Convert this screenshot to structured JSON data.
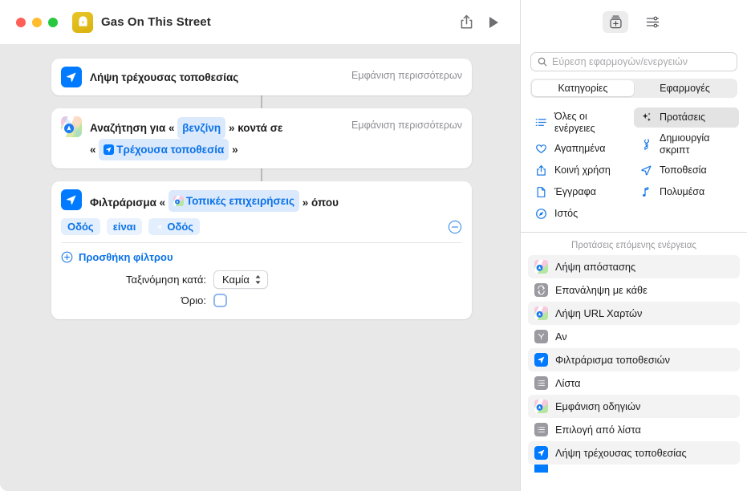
{
  "window": {
    "title": "Gas On This Street",
    "app_icon": "gas-pump-icon",
    "traffic_lights": [
      "close",
      "minimize",
      "zoom"
    ],
    "toolbar": {
      "share_label": "share-icon",
      "play_label": "play-icon"
    }
  },
  "workflow": {
    "actions": [
      {
        "icon": "location-arrow-icon",
        "text_before": "Λήψη τρέχουσας τοποθεσίας",
        "show_more": "Εμφάνιση περισσότερων"
      },
      {
        "icon": "maps-icon",
        "prefix": "Αναζήτηση για «",
        "token1": "βενζίνη",
        "middle": "» κοντά σε",
        "open_quote": "«",
        "token2": "Τρέχουσα τοποθεσία",
        "close_quote": "»",
        "show_more": "Εμφάνιση περισσότερων"
      },
      {
        "icon": "location-arrow-icon",
        "prefix": "Φιλτράρισμα «",
        "token": "Τοπικές επιχειρήσεις",
        "suffix": "» όπου",
        "filter_row": {
          "field": "Οδός",
          "operator": "είναι",
          "value": "Οδός"
        },
        "add_filter": "Προσθήκη φίλτρου",
        "sort_label": "Ταξινόμηση κατά:",
        "sort_value": "Καμία",
        "limit_label": "Όριο:",
        "limit_checked": false
      }
    ]
  },
  "sidebar": {
    "top_tabs": [
      {
        "name": "library-add-icon",
        "active": true
      },
      {
        "name": "sliders-icon",
        "active": false
      }
    ],
    "search": {
      "placeholder": "Εύρεση εφαρμογών/ενεργειών",
      "value": ""
    },
    "segmented": {
      "options": [
        "Κατηγορίες",
        "Εφαρμογές"
      ],
      "selected": "Κατηγορίες"
    },
    "categories_left": [
      {
        "icon": "list-bullet-icon",
        "label": "Όλες οι ενέργειες",
        "selected": false
      },
      {
        "icon": "heart-icon",
        "label": "Αγαπημένα",
        "selected": false
      },
      {
        "icon": "share-up-icon",
        "label": "Κοινή χρήση",
        "selected": false
      },
      {
        "icon": "document-icon",
        "label": "Έγγραφα",
        "selected": false
      },
      {
        "icon": "safari-compass-icon",
        "label": "Ιστός",
        "selected": false
      }
    ],
    "categories_right": [
      {
        "icon": "sparkles-icon",
        "label": "Προτάσεις",
        "selected": true
      },
      {
        "icon": "script-icon",
        "label": "Δημιουργία σκριπτ",
        "selected": false
      },
      {
        "icon": "location-arrow-icon",
        "label": "Τοποθεσία",
        "selected": false
      },
      {
        "icon": "music-note-icon",
        "label": "Πολυμέσα",
        "selected": false
      }
    ],
    "suggestions_header": "Προτάσεις επόμενης ενέργειας",
    "suggestions": [
      {
        "icon": "maps-icon",
        "label": "Λήψη απόστασης",
        "alt": true
      },
      {
        "icon": "repeat-icon",
        "label": "Επανάληψη με κάθε",
        "alt": false
      },
      {
        "icon": "maps-icon",
        "label": "Λήψη URL Χαρτών",
        "alt": true
      },
      {
        "icon": "if-icon",
        "label": "Αν",
        "alt": false
      },
      {
        "icon": "location-arrow-icon",
        "label": "Φιλτράρισμα τοποθεσιών",
        "alt": true
      },
      {
        "icon": "list-icon",
        "label": "Λίστα",
        "alt": false
      },
      {
        "icon": "maps-icon",
        "label": "Εμφάνιση οδηγιών",
        "alt": true
      },
      {
        "icon": "list-select-icon",
        "label": "Επιλογή από λίστα",
        "alt": false
      },
      {
        "icon": "location-arrow-icon",
        "label": "Λήψη τρέχουσας τοποθεσίας",
        "alt": true
      }
    ]
  },
  "colors": {
    "accent_blue": "#007aff",
    "token_blue": "#0a72e8",
    "token_bg": "#dbe9fd",
    "canvas_grey": "#e8e8e8",
    "app_icon_gold": "#e0bb19"
  }
}
